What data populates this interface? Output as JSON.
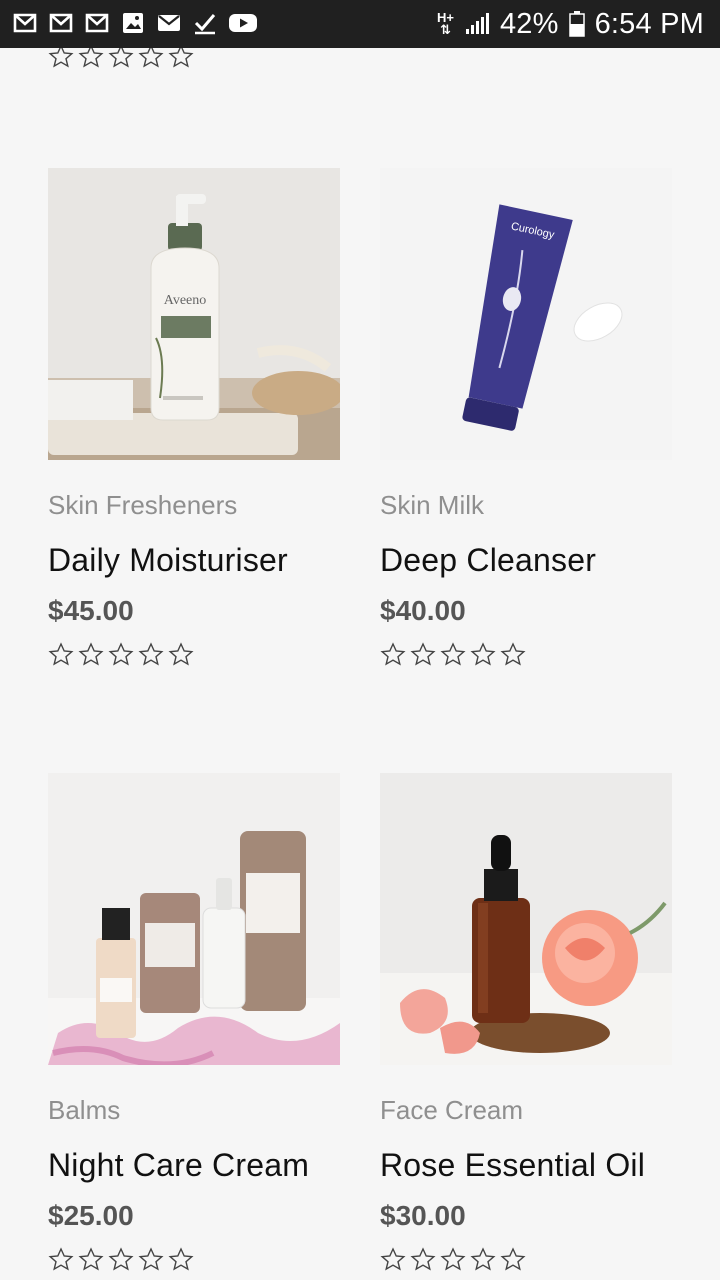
{
  "status_bar": {
    "network": "H+",
    "battery": "42%",
    "time": "6:54 PM",
    "notification_icons": [
      "gmail-icon",
      "gmail-icon",
      "gmail-icon",
      "image-icon",
      "mail-icon",
      "check-icon",
      "youtube-icon"
    ]
  },
  "products": [
    {
      "category": "Skin Fresheners",
      "name": "Daily Moisturiser",
      "price": "$45.00",
      "rating": 0,
      "image": "moisturiser-bottle-photo"
    },
    {
      "category": "Skin Milk",
      "name": "Deep Cleanser",
      "price": "$40.00",
      "rating": 0,
      "image": "cleanser-tube-photo"
    },
    {
      "category": "Balms",
      "name": "Night Care Cream",
      "price": "$25.00",
      "rating": 0,
      "image": "skincare-set-photo"
    },
    {
      "category": "Face Cream",
      "name": "Rose Essential Oil",
      "price": "$30.00",
      "rating": 0,
      "image": "rose-oil-bottle-photo"
    }
  ],
  "colors": {
    "background": "#f6f6f6",
    "status_bar": "#202020",
    "category": "#8f8f8f",
    "price": "#555555"
  }
}
